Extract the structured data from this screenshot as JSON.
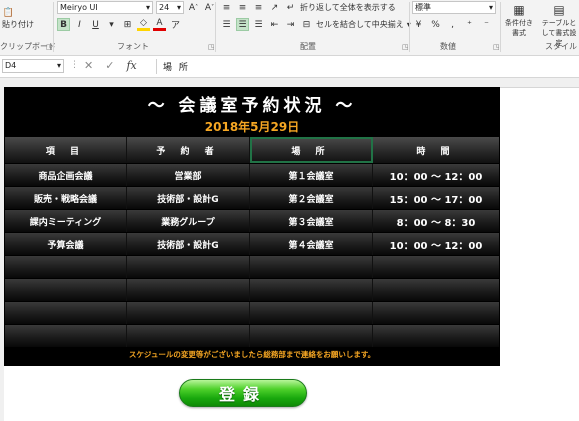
{
  "ribbon": {
    "paste_label": "貼り付け",
    "clipboard_label": "クリップボード",
    "font_group_label": "フォント",
    "alignment_group_label": "配置",
    "number_group_label": "数値",
    "style_group_label": "スタイル",
    "font_name": "Meiryo UI",
    "font_size": "24",
    "wrap_text_label": "折り返して全体を表示する",
    "merge_center_label": "セルを結合して中央揃え",
    "number_format": "標準",
    "conditional_format_label": "条件付き書式",
    "table_format_label": "テーブルとして書式設定"
  },
  "formula_bar": {
    "cell_ref": "D4",
    "value": "場 所"
  },
  "board": {
    "title": "～ 会議室予約状況 ～",
    "date": "2018年5月29日",
    "headers": [
      "項 目",
      "予 約 者",
      "場 所",
      "時 間"
    ],
    "rows": [
      [
        "商品企画会議",
        "営業部",
        "第１会議室",
        "10：00 ～ 12：00"
      ],
      [
        "販売・戦略会議",
        "技術部・設計G",
        "第２会議室",
        "15：00 ～ 17：00"
      ],
      [
        "課内ミーティング",
        "業務グループ",
        "第３会議室",
        "8：00 ～ 8：30"
      ],
      [
        "予算会議",
        "技術部・設計G",
        "第４会議室",
        "10：00 ～ 12：00"
      ],
      [
        "",
        "",
        "",
        ""
      ],
      [
        "",
        "",
        "",
        ""
      ],
      [
        "",
        "",
        "",
        ""
      ],
      [
        "",
        "",
        "",
        ""
      ]
    ],
    "note": "スケジュールの変更等がございましたら総務部まで連絡をお願いします。"
  },
  "register_button": {
    "label": "登録"
  },
  "colors": {
    "board_bg": "#000000",
    "date_color": "#f5a623",
    "button_green": "#19a80d",
    "selection": "#217346"
  }
}
